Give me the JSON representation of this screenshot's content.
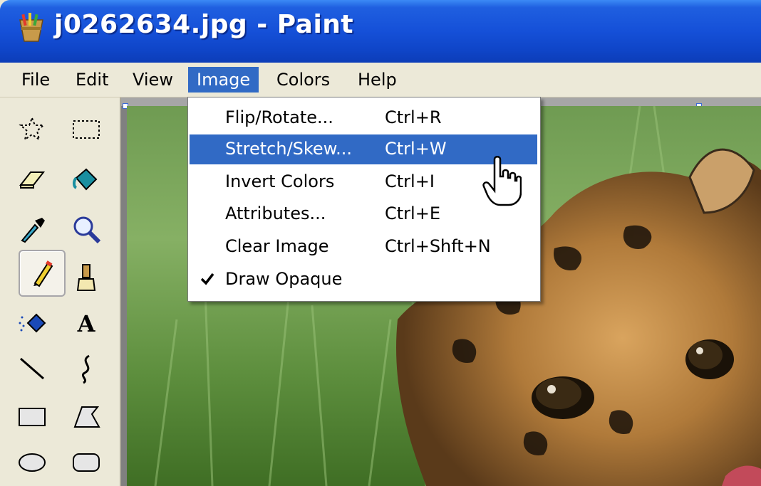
{
  "window": {
    "title": "j0262634.jpg - Paint"
  },
  "menubar": {
    "items": [
      {
        "label": "File"
      },
      {
        "label": "Edit"
      },
      {
        "label": "View"
      },
      {
        "label": "Image"
      },
      {
        "label": "Colors"
      },
      {
        "label": "Help"
      }
    ]
  },
  "image_menu": {
    "items": [
      {
        "label": "Flip/Rotate...",
        "shortcut": "Ctrl+R"
      },
      {
        "label": "Stretch/Skew...",
        "shortcut": "Ctrl+W"
      },
      {
        "label": "Invert Colors",
        "shortcut": "Ctrl+I"
      },
      {
        "label": "Attributes...",
        "shortcut": "Ctrl+E"
      },
      {
        "label": "Clear Image",
        "shortcut": "Ctrl+Shft+N"
      },
      {
        "label": "Draw Opaque",
        "shortcut": ""
      }
    ]
  },
  "toolbox": {
    "tools": [
      "free-form-select-icon",
      "rect-select-icon",
      "eraser-icon",
      "fill-bucket-icon",
      "color-picker-icon",
      "magnifier-icon",
      "pencil-icon",
      "brush-icon",
      "airbrush-icon",
      "text-icon",
      "line-icon",
      "curve-icon",
      "rectangle-icon",
      "polygon-icon",
      "ellipse-icon",
      "rounded-rect-icon"
    ],
    "selected": "pencil-icon"
  },
  "colors": {
    "titlebar": "#1550d8",
    "highlight": "#316ac5",
    "chrome": "#ece9d8"
  }
}
